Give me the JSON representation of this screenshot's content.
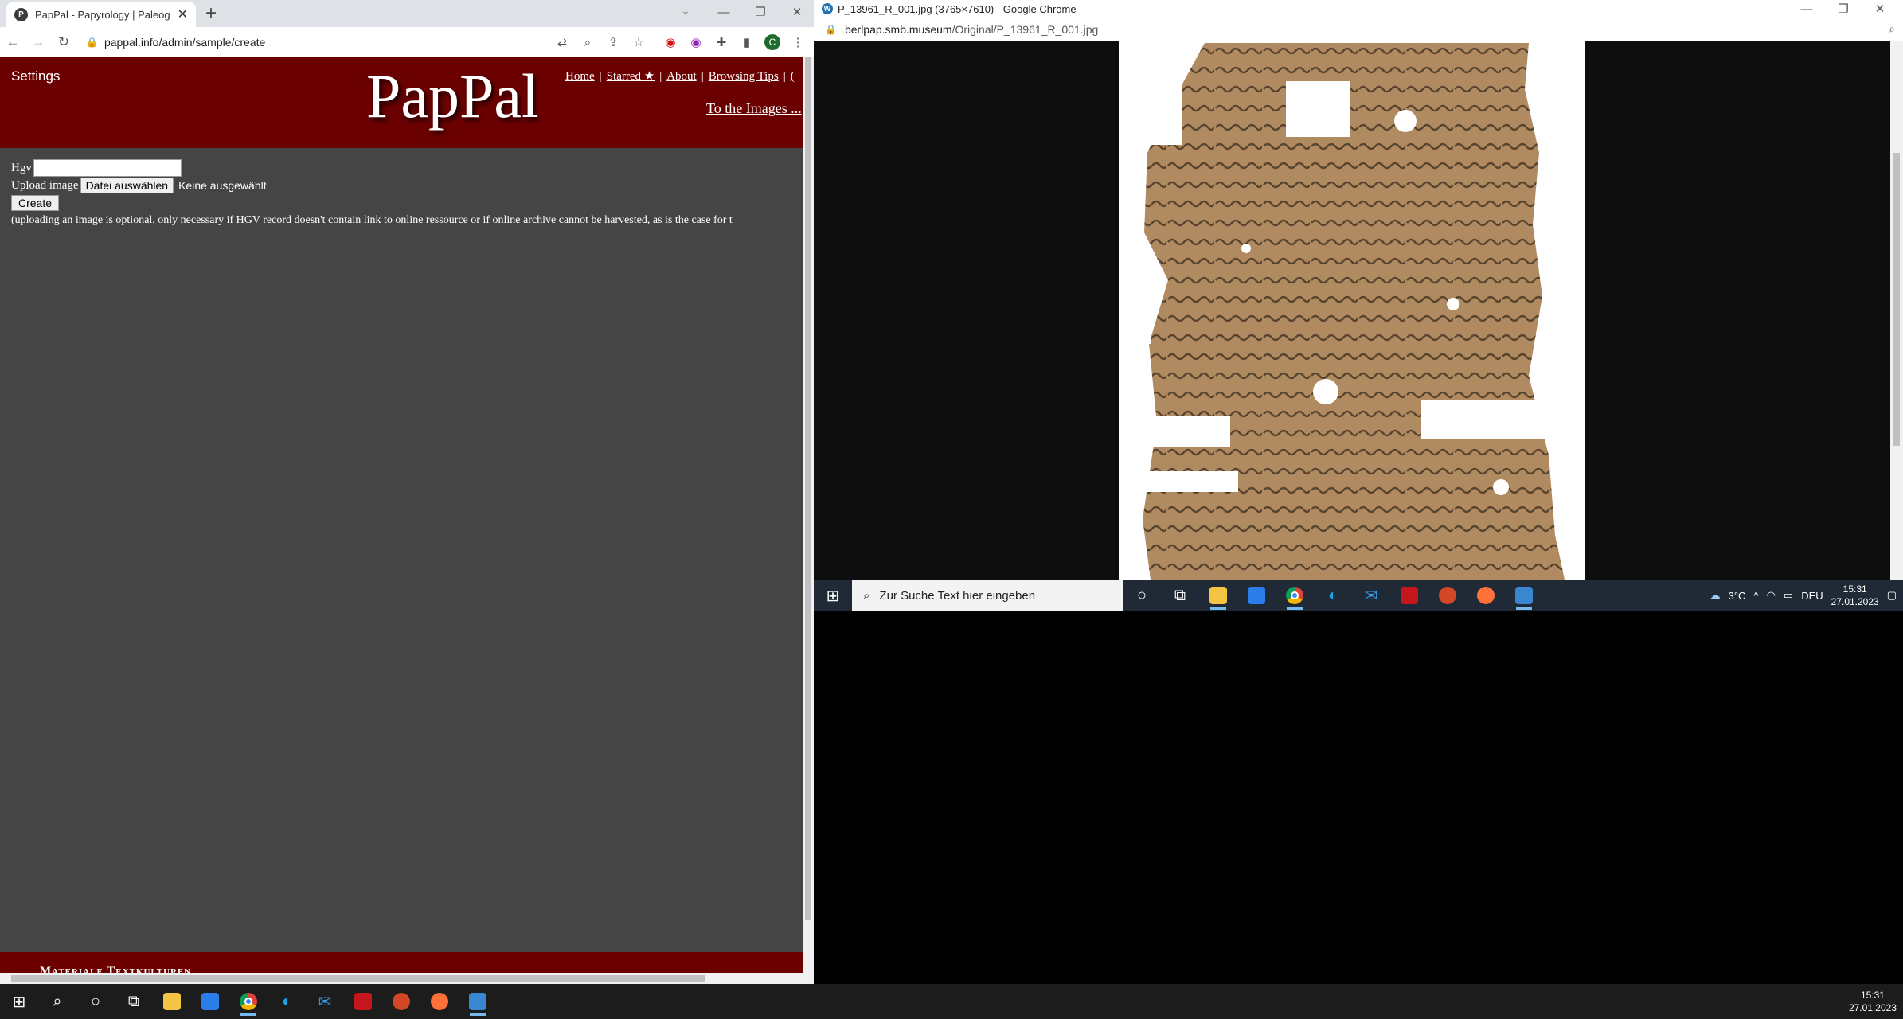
{
  "left_browser": {
    "tab_title": "PapPal - Papyrology | Paleograph",
    "tab_favicon": "P",
    "new_tab": "+",
    "url": "pappal.info/admin/sample/create"
  },
  "site": {
    "settings_label": "Settings",
    "logo_text": "PapPal",
    "nav": [
      "Home",
      "Starred ★",
      "About",
      "Browsing Tips",
      "("
    ],
    "to_images": "To the Images ...",
    "form": {
      "hgv_label": "Hgv",
      "hgv_value": "",
      "upload_label": "Upload image",
      "file_button": "Datei auswählen",
      "file_status": "Keine ausgewählt",
      "create_button": "Create",
      "note": "(uploading an image is optional, only necessary if HGV record doesn't contain link to online ressource or if online archive cannot be harvested, as is the case for t"
    },
    "footer_text": "Materiale Textkulturen"
  },
  "right_browser": {
    "title": "P_13961_R_001.jpg (3765×7610) - Google Chrome",
    "url_domain": "berlpap.smb.museum",
    "url_path": "/Original/P_13961_R_001.jpg"
  },
  "taskbar_small": {
    "search_placeholder": "Zur Suche Text hier eingeben",
    "weather": "3°C",
    "lang": "DEU",
    "time": "15:31",
    "date": "27.01.2023"
  },
  "taskbar_main": {
    "time": "15:31",
    "date": "27.01.2023"
  },
  "colors": {
    "header_bg": "#6b0000",
    "page_bg": "#454545"
  }
}
